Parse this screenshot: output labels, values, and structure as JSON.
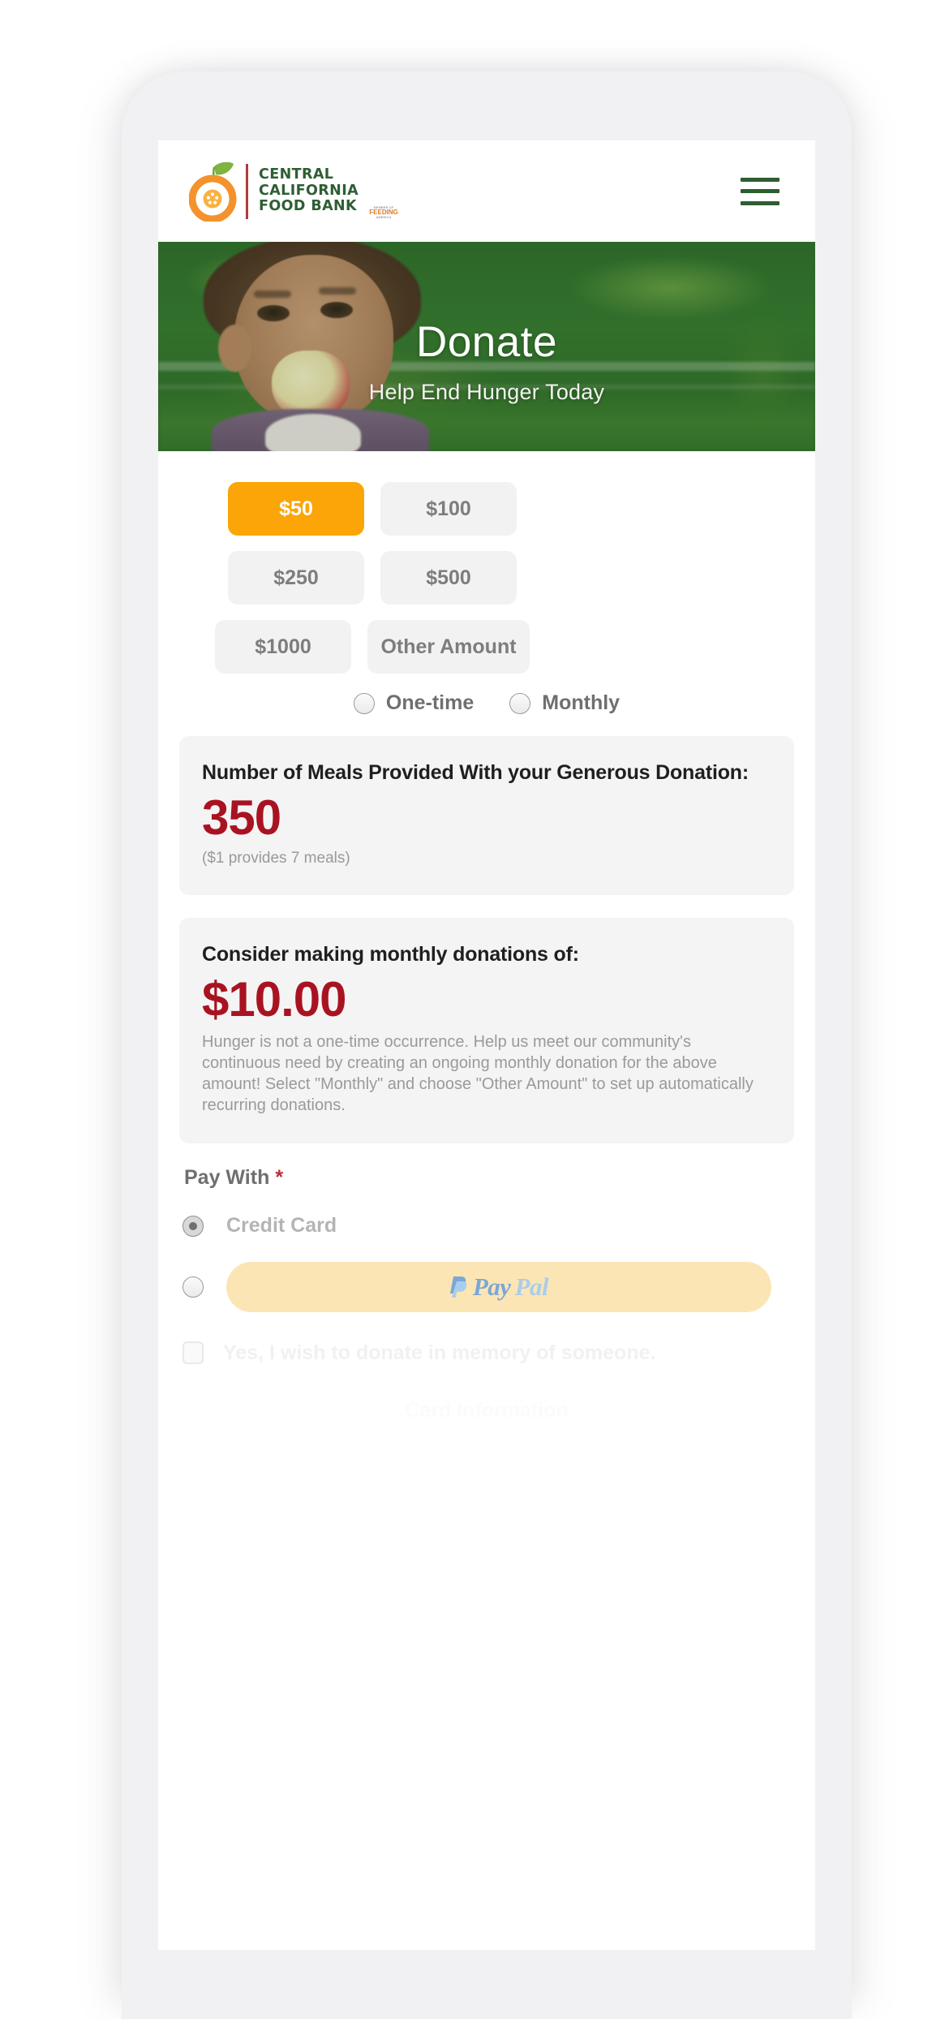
{
  "header": {
    "logo": {
      "line1": "CENTRAL",
      "line2": "CALIFORNIA",
      "line3": "FOOD BANK",
      "partner_small": "MEMBER OF",
      "partner_big": "FEEDING",
      "partner_sub": "AMERICA"
    },
    "menu_label": "Menu"
  },
  "hero": {
    "title": "Donate",
    "subtitle": "Help End Hunger Today"
  },
  "amounts": {
    "rows": [
      [
        {
          "label": "$50",
          "selected": true
        },
        {
          "label": "$100",
          "selected": false
        }
      ],
      [
        {
          "label": "$250",
          "selected": false
        },
        {
          "label": "$500",
          "selected": false
        }
      ],
      [
        {
          "label": "$1000",
          "selected": false
        },
        {
          "label": "Other Amount",
          "selected": false
        }
      ]
    ]
  },
  "frequency": {
    "options": [
      {
        "label": "One-time",
        "selected": false
      },
      {
        "label": "Monthly",
        "selected": false
      }
    ]
  },
  "meals_card": {
    "heading": "Number of Meals Provided With your Generous Donation:",
    "value": "350",
    "note": "($1 provides 7 meals)"
  },
  "monthly_card": {
    "heading": "Consider making monthly donations of:",
    "value": "$10.00",
    "paragraph": "Hunger is not a one-time occurrence. Help us meet our community's continuous need by creating an ongoing monthly donation for the above amount! Select \"Monthly\" and choose \"Other Amount\" to set up automatically recurring donations."
  },
  "payment": {
    "label": "Pay With",
    "required_marker": "*",
    "credit_card_label": "Credit Card",
    "credit_card_selected": true,
    "paypal_selected": false,
    "paypal_pay": "Pay",
    "paypal_pal": "Pal"
  },
  "memory": {
    "checkbox_label": "Yes, I wish to donate in memory of someone.",
    "checked": false
  },
  "card_section": {
    "title": "Card Information"
  },
  "colors": {
    "accent_orange": "#fba508",
    "brand_green": "#2f5d32",
    "brand_red": "#a91321",
    "required_red": "#b8303c",
    "paypal_bg": "#fce5b5"
  }
}
